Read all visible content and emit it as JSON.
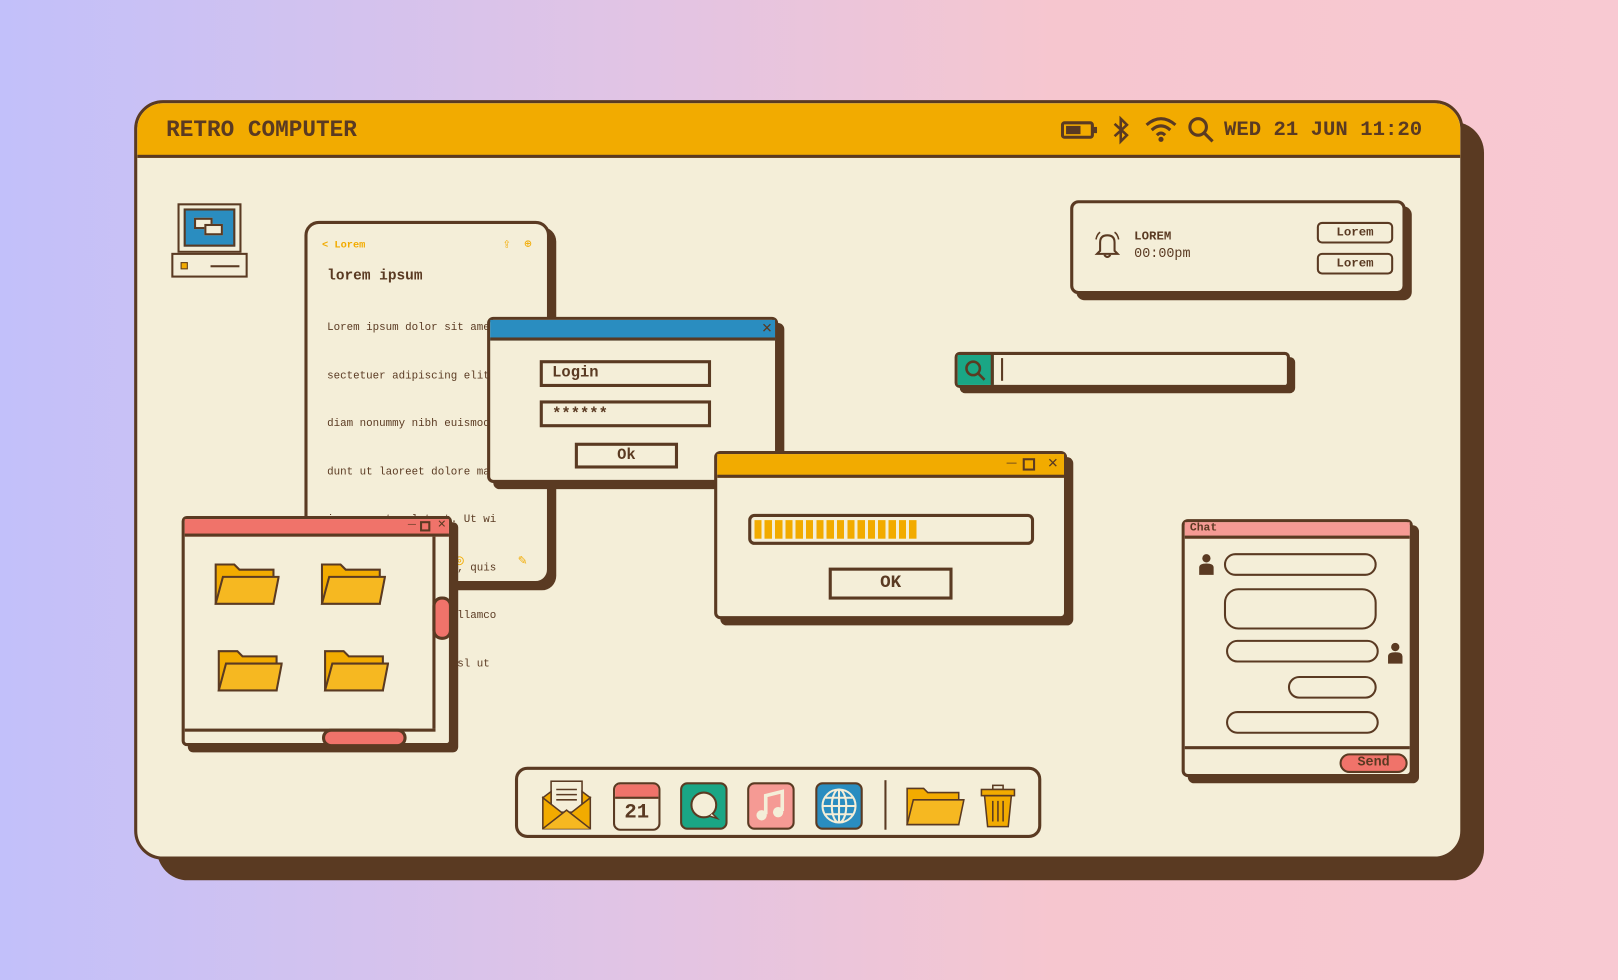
{
  "menubar": {
    "title": "RETRO COMPUTER",
    "datetime": "WED 21 JUN 11:20",
    "icons": [
      "battery-icon",
      "bluetooth-icon",
      "wifi-icon",
      "search-icon"
    ]
  },
  "notes": {
    "back_label": "Lorem",
    "heading": "lorem ipsum",
    "lines": [
      "Lorem ipsum dolor sit amet, con-",
      "sectetuer adipiscing elit, sed",
      "diam nonummy nibh euismod",
      "dunt ut laoreet dolore mag",
      "iquam erat volutpat. Ut wi",
      "enim ad minim veniam, quis",
      "trud exerci tation ullamco",
      "suscipit lobortis nisl ut"
    ]
  },
  "login": {
    "username": "Login",
    "password": "******",
    "ok_label": "Ok"
  },
  "progress": {
    "percent": 60,
    "ok_label": "OK"
  },
  "notification": {
    "title": "LOREM",
    "time": "00:00pm",
    "button1": "Lorem",
    "button2": "Lorem"
  },
  "search": {
    "value": ""
  },
  "chat": {
    "title": "Chat",
    "send_label": "Send"
  },
  "dock": {
    "items": [
      "mail",
      "calendar",
      "messages",
      "music",
      "browser",
      "folder",
      "trash"
    ],
    "calendar_day": "21"
  },
  "colors": {
    "cream": "#f4eed8",
    "brown": "#5a3a22",
    "yellow": "#f2ab00",
    "blue": "#2a8dc0",
    "coral": "#f0736a",
    "pink": "#f59a94",
    "green": "#1aa685"
  }
}
